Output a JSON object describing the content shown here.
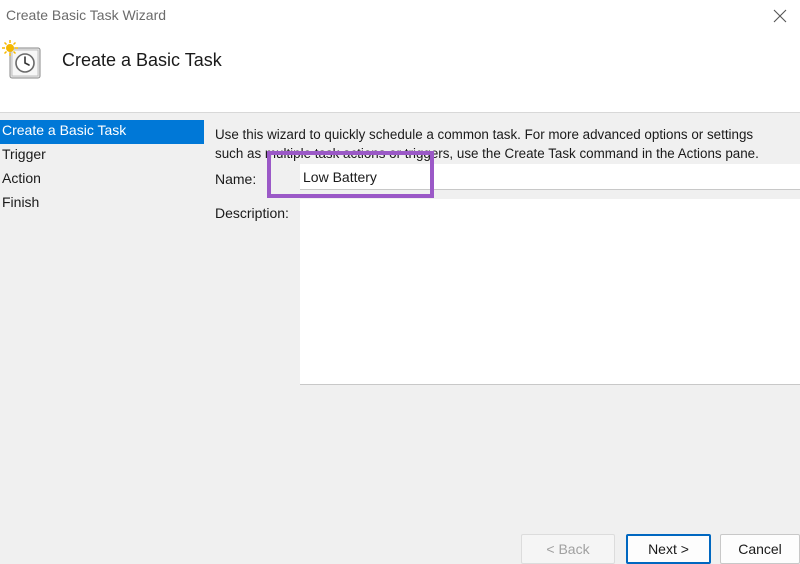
{
  "window": {
    "title": "Create Basic Task Wizard"
  },
  "header": {
    "title": "Create a Basic Task"
  },
  "steps": [
    {
      "label": "Create a Basic Task",
      "active": true
    },
    {
      "label": "Trigger",
      "active": false
    },
    {
      "label": "Action",
      "active": false
    },
    {
      "label": "Finish",
      "active": false
    }
  ],
  "intro": {
    "line1": "Use this wizard to quickly schedule a common task.  For more advanced options or settings",
    "line2": "such as multiple task actions or triggers, use the Create Task command in the Actions pane."
  },
  "form": {
    "name_label": "Name:",
    "name_value": "Low Battery",
    "description_label": "Description:",
    "description_value": ""
  },
  "buttons": {
    "back": "< Back",
    "next": "Next >",
    "cancel": "Cancel"
  },
  "colors": {
    "accent": "#0078d7",
    "highlight_box": "#9b59c7"
  },
  "icons": {
    "window_close": "close-icon",
    "header": "scheduled-task-clock-icon"
  }
}
